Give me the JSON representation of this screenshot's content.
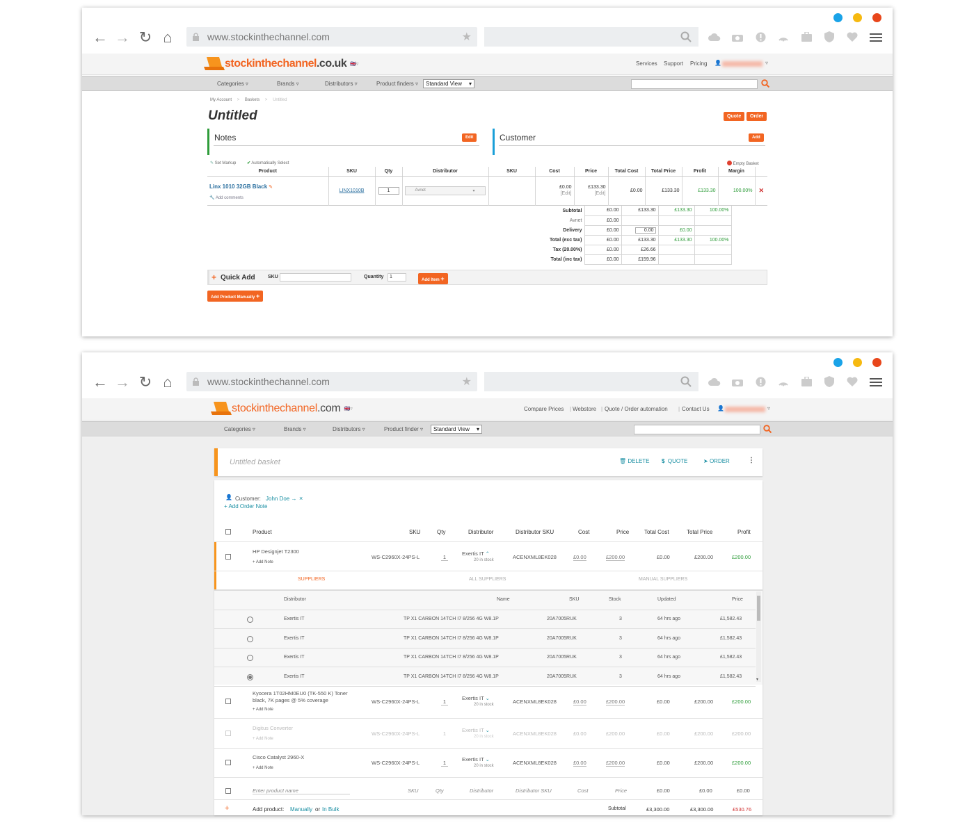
{
  "colors": {
    "dot1": "#1aa3e8",
    "dot2": "#f6b910",
    "dot3": "#e8461b",
    "accent": "#f26522",
    "teal": "#1a8fa3",
    "green": "#2e9c3a",
    "red": "#d03030"
  },
  "w1": {
    "url": "www.stockinthechannel.com",
    "logo": {
      "part1": "stockinthechannel",
      "part2": ".co.uk"
    },
    "toplinks": [
      "Services",
      "Support",
      "Pricing"
    ],
    "nav": [
      "Categories",
      "Brands",
      "Distributors",
      "Product finders"
    ],
    "view_select": "Standard View",
    "breadcrumb": [
      "My Account",
      "Baskets",
      "Untitled"
    ],
    "title": "Untitled",
    "quote_btn": "Quote",
    "order_btn": "Order",
    "notes": {
      "title": "Notes",
      "button": "Edit"
    },
    "customer": {
      "title": "Customer",
      "button": "Add"
    },
    "set_markup": "Set Markup",
    "auto_select": "Automatically Select",
    "empty_basket": "Empty Basket",
    "headers": [
      "Product",
      "SKU",
      "Qty",
      "Distributor",
      "SKU",
      "Cost",
      "Price",
      "Total Cost",
      "Total Price",
      "Profit",
      "Margin"
    ],
    "row": {
      "product": "Linx 1010 32GB Black",
      "add_comments": "Add comments",
      "sku": "LINX1010B",
      "qty": "1",
      "distributor": "Avnet",
      "cost": "£0.00",
      "cost_edit": "[Edit]",
      "price": "£133.30",
      "price_edit": "[Edit]",
      "total_cost": "£0.00",
      "total_price": "£133.30",
      "profit": "£133.30",
      "margin": "100.00%"
    },
    "summary": [
      {
        "label": "Subtotal",
        "cost": "£0.00",
        "price": "£133.30",
        "profit": "£133.30",
        "margin": "100.00%"
      },
      {
        "label": "Avnet",
        "cost": "£0.00",
        "price": "",
        "profit": "",
        "margin": ""
      },
      {
        "label": "Delivery",
        "cost": "£0.00",
        "price": "0.00",
        "profit": "£0.00",
        "margin": ""
      },
      {
        "label": "Total (exc tax)",
        "cost": "£0.00",
        "price": "£133.30",
        "profit": "£133.30",
        "margin": "100.00%"
      },
      {
        "label": "Tax (20.00%)",
        "cost": "£0.00",
        "price": "£26.66",
        "profit": "",
        "margin": ""
      },
      {
        "label": "Total (inc tax)",
        "cost": "£0.00",
        "price": "£159.96",
        "profit": "",
        "margin": ""
      }
    ],
    "quick_add": {
      "title": "Quick Add",
      "sku_label": "SKU",
      "qty_label": "Quantity",
      "qty_value": "1",
      "add_item": "Add Item"
    },
    "add_manually": "Add Product Manually"
  },
  "w2": {
    "url": "www.stockinthechannel.com",
    "logo": {
      "part1": "stockinthechannel",
      ".com": ".com",
      "part2": ".com"
    },
    "toplinks": [
      "Compare Prices",
      "Webstore",
      "Quote / Order automation",
      "Contact Us"
    ],
    "nav": [
      "Categories",
      "Brands",
      "Distributors",
      "Product finder"
    ],
    "view_select": "Standard View",
    "basket_title": "Untitled basket",
    "actions": [
      "DELETE",
      "QUOTE",
      "ORDER"
    ],
    "customer_label": "Customer:",
    "customer_name": "John Doe",
    "add_order_note": "+ Add Order Note",
    "headers": [
      "Product",
      "SKU",
      "Qty",
      "Distributor",
      "Distributor SKU",
      "Cost",
      "Price",
      "Total Cost",
      "Total Price",
      "Profit"
    ],
    "rows": [
      {
        "product": "HP Designjet T2300",
        "note": "+ Add Note",
        "sku": "WS-C2960X-24PS-L",
        "qty": "1",
        "dist": "Exertis IT",
        "stock": "20 in stock",
        "dsku": "ACENXML8EK028",
        "cost": "£0.00",
        "price": "£200.00",
        "tcost": "£0.00",
        "tprice": "£200.00",
        "profit": "£200.00"
      },
      {
        "product": "Kyocera 1T02HM0EU0 (TK-550 K) Toner black, 7K pages @ 5% coverage",
        "note": "+ Add Note",
        "sku": "WS-C2960X-24PS-L",
        "qty": "1",
        "dist": "Exertis IT",
        "stock": "20 in stock",
        "dsku": "ACENXML8EK028",
        "cost": "£0.00",
        "price": "£200.00",
        "tcost": "£0.00",
        "tprice": "£200.00",
        "profit": "£200.00"
      },
      {
        "product": "Digitus Converter",
        "note": "+ Add Note",
        "sku": "WS-C2960X-24PS-L",
        "qty": "1",
        "dist": "Exertis IT",
        "stock": "20 in stock",
        "dsku": "ACENXML8EK028",
        "cost": "£0.00",
        "price": "£200.00",
        "tcost": "£0.00",
        "tprice": "£200.00",
        "profit": "£200.00"
      },
      {
        "product": "Cisco Catalyst 2960-X",
        "note": "+ Add Note",
        "sku": "WS-C2960X-24PS-L",
        "qty": "1",
        "dist": "Exertis IT",
        "stock": "20 in stock",
        "dsku": "ACENXML8EK028",
        "cost": "£0.00",
        "price": "£200.00",
        "tcost": "£0.00",
        "tprice": "£200.00",
        "profit": "£200.00"
      }
    ],
    "tabs": [
      "SUPPLIERS",
      "ALL SUPPLIERS",
      "MANUAL SUPPLIERS"
    ],
    "sup_headers": [
      "Distributor",
      "Name",
      "SKU",
      "Stock",
      "Updated",
      "Price"
    ],
    "suppliers": [
      {
        "dist": "Exertis IT",
        "name": "TP X1 CARBON 14TCH I7 8/256 4G W8.1P",
        "sku": "20A7005RUK",
        "stock": "3",
        "updated": "64 hrs ago",
        "price": "£1,582.43"
      },
      {
        "dist": "Exertis IT",
        "name": "TP X1 CARBON 14TCH I7 8/256 4G W8.1P",
        "sku": "20A7005RUK",
        "stock": "3",
        "updated": "64 hrs ago",
        "price": "£1,582.43"
      },
      {
        "dist": "Exertis IT",
        "name": "TP X1 CARBON 14TCH I7 8/256 4G W8.1P",
        "sku": "20A7005RUK",
        "stock": "3",
        "updated": "64 hrs ago",
        "price": "£1,582.43"
      },
      {
        "dist": "Exertis IT",
        "name": "TP X1 CARBON 14TCH I7 8/256 4G W8.1P",
        "sku": "20A7005RUK",
        "stock": "3",
        "updated": "64 hrs ago",
        "price": "£1,582.43"
      }
    ],
    "new_row": {
      "product": "Enter product name",
      "sku": "SKU",
      "qty": "Qty",
      "dist": "Distributor",
      "dsku": "Distributor SKU",
      "cost": "Cost",
      "price": "Price",
      "tcost": "£0.00",
      "tprice": "£0.00",
      "profit": "£0.00"
    },
    "add_product": "Add product:",
    "manually": "Manually",
    "or": "or",
    "in_bulk": "In Bulk",
    "subtotal": {
      "label": "Subtotal",
      "tcost": "£3,300.00",
      "tprice": "£3,300.00",
      "profit": "£530.76"
    }
  }
}
